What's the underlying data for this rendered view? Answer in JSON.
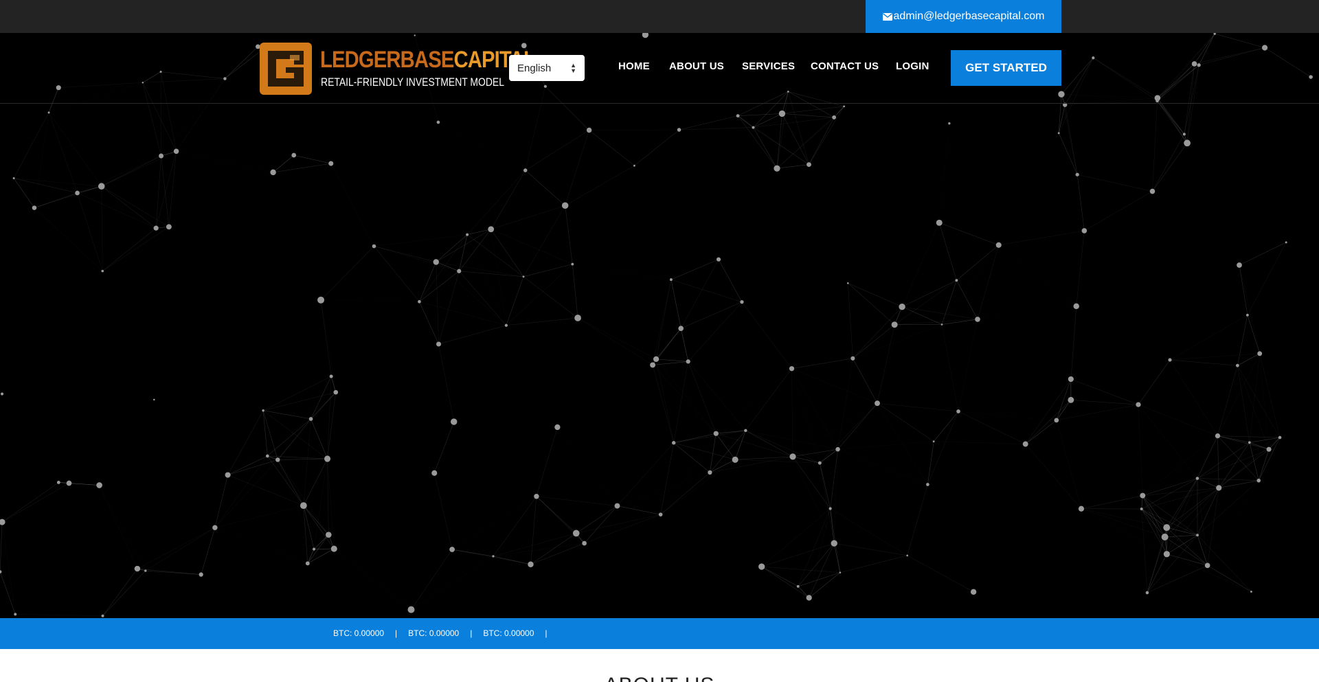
{
  "topbar": {
    "email": "admin@ledgerbasecapital.com",
    "email_icon": "envelope-icon"
  },
  "logo": {
    "brand_part1": "LEDGERBASE",
    "brand_part2": "CAPITAL",
    "tagline": "RETAIL-FRIENDLY INVESTMENT MODEL"
  },
  "language": {
    "selected": "English"
  },
  "nav": {
    "items": [
      "HOME",
      "ABOUT US",
      "SERVICES",
      "CONTACT US",
      "LOGIN"
    ],
    "cta": "GET STARTED"
  },
  "ticker": {
    "items": [
      "BTC: 0.00000",
      "BTC: 0.00000",
      "BTC: 0.00000"
    ],
    "separator": "|"
  },
  "about": {
    "title": "ABOUT US"
  },
  "colors": {
    "accent": "#0a7fdc",
    "topbar": "#232323",
    "logo_orange": "#e8861c"
  }
}
